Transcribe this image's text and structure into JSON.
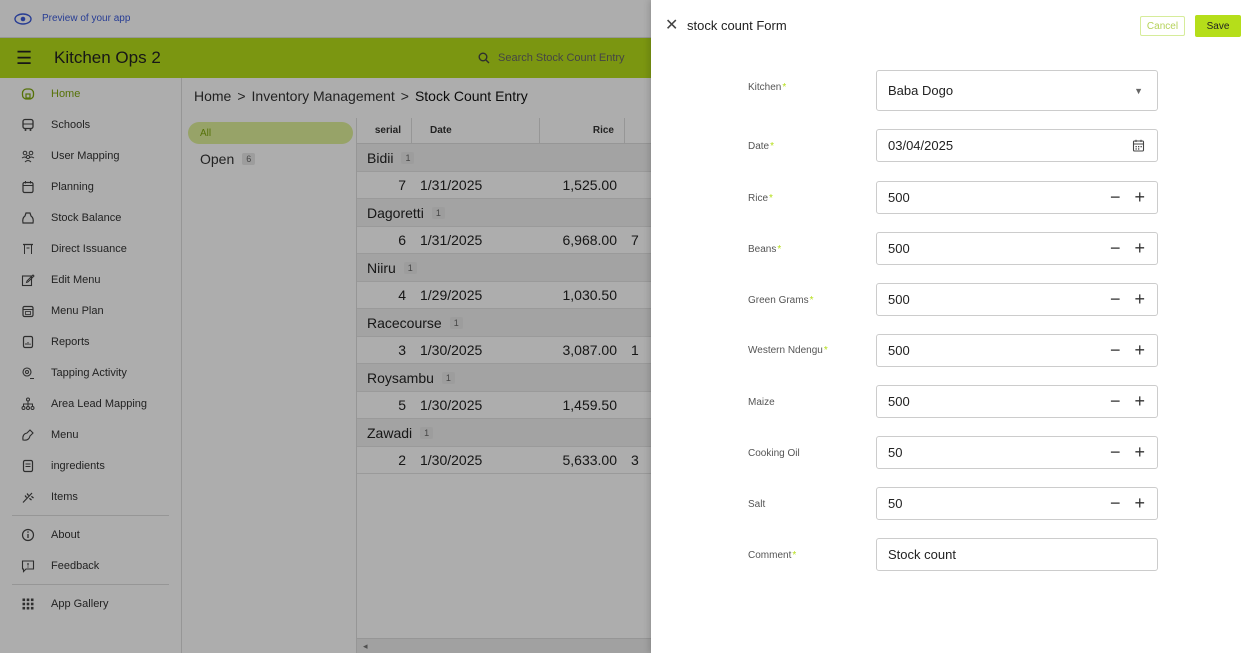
{
  "preview": {
    "label": "Preview of your app"
  },
  "app": {
    "title": "Kitchen Ops 2"
  },
  "search": {
    "placeholder": "Search Stock Count Entry"
  },
  "sidebar": {
    "items": [
      {
        "label": "Home",
        "icon": "home-icon",
        "active": true
      },
      {
        "label": "Schools",
        "icon": "bus-icon"
      },
      {
        "label": "User Mapping",
        "icon": "users-icon"
      },
      {
        "label": "Planning",
        "icon": "calendar-icon"
      },
      {
        "label": "Stock Balance",
        "icon": "bag-icon"
      },
      {
        "label": "Direct Issuance",
        "icon": "issuance-icon"
      },
      {
        "label": "Edit Menu",
        "icon": "edit-icon"
      },
      {
        "label": "Menu Plan",
        "icon": "calendar-icon"
      },
      {
        "label": "Reports",
        "icon": "report-icon"
      },
      {
        "label": "Tapping Activity",
        "icon": "tap-icon"
      },
      {
        "label": "Area Lead Mapping",
        "icon": "hierarchy-icon"
      },
      {
        "label": "Menu",
        "icon": "menu-icon"
      },
      {
        "label": "ingredients",
        "icon": "document-icon"
      },
      {
        "label": "Items",
        "icon": "wheat-icon"
      }
    ],
    "footer": [
      {
        "label": "About",
        "icon": "info-icon"
      },
      {
        "label": "Feedback",
        "icon": "feedback-icon"
      },
      {
        "label": "App Gallery",
        "icon": "grid-icon"
      }
    ]
  },
  "breadcrumb": {
    "home": "Home",
    "sep": ">",
    "section": "Inventory Management",
    "current": "Stock Count Entry"
  },
  "filter": {
    "all": "All",
    "open": "Open",
    "open_count": "6"
  },
  "grid": {
    "columns": {
      "serial": "serial",
      "date": "Date",
      "rice": "Rice"
    },
    "groups": [
      {
        "name": "Bidii",
        "count": "1",
        "row": {
          "serial": "7",
          "date": "1/31/2025",
          "rice": "1,525.00",
          "extra": ""
        }
      },
      {
        "name": "Dagoretti",
        "count": "1",
        "row": {
          "serial": "6",
          "date": "1/31/2025",
          "rice": "6,968.00",
          "extra": "7"
        }
      },
      {
        "name": "Niiru",
        "count": "1",
        "row": {
          "serial": "4",
          "date": "1/29/2025",
          "rice": "1,030.50",
          "extra": ""
        }
      },
      {
        "name": "Racecourse",
        "count": "1",
        "row": {
          "serial": "3",
          "date": "1/30/2025",
          "rice": "3,087.00",
          "extra": "1"
        }
      },
      {
        "name": "Roysambu",
        "count": "1",
        "row": {
          "serial": "5",
          "date": "1/30/2025",
          "rice": "1,459.50",
          "extra": ""
        }
      },
      {
        "name": "Zawadi",
        "count": "1",
        "row": {
          "serial": "2",
          "date": "1/30/2025",
          "rice": "5,633.00",
          "extra": "3"
        }
      }
    ],
    "scroll_arrow": "◂"
  },
  "form": {
    "title": "stock count Form",
    "cancel": "Cancel",
    "save": "Save",
    "required_mark": "*",
    "fields": {
      "kitchen": {
        "label": "Kitchen",
        "value": "Baba Dogo",
        "required": true
      },
      "date": {
        "label": "Date",
        "value": "03/04/2025",
        "required": true
      },
      "rice": {
        "label": "Rice",
        "value": "500",
        "required": true
      },
      "beans": {
        "label": "Beans",
        "value": "500",
        "required": true
      },
      "green_grams": {
        "label": "Green Grams",
        "value": "500",
        "required": true
      },
      "western_ndengu": {
        "label": "Western Ndengu",
        "value": "500",
        "required": true
      },
      "maize": {
        "label": "Maize",
        "value": "500",
        "required": false
      },
      "cooking_oil": {
        "label": "Cooking Oil",
        "value": "50",
        "required": false
      },
      "salt": {
        "label": "Salt",
        "value": "50",
        "required": false
      },
      "comment": {
        "label": "Comment",
        "value": "Stock count",
        "required": true
      }
    },
    "stepper": {
      "minus": "−",
      "plus": "+"
    }
  },
  "colors": {
    "accent": "#b5de1a",
    "accent_text": "#7fa80c",
    "link": "#3b5bdb"
  }
}
